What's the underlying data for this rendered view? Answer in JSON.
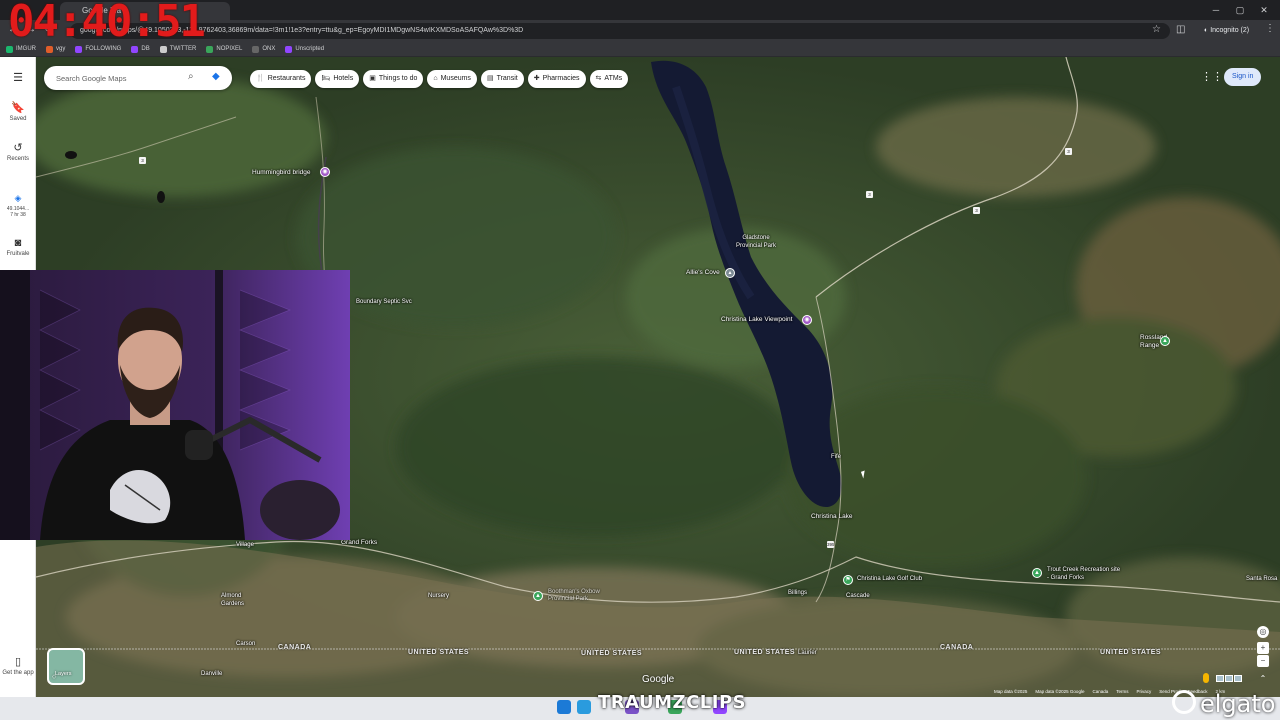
{
  "overlay": {
    "timer": "04:40:51",
    "clips_watermark": "TRAUMZCLIPS",
    "camera_brand": "elgato"
  },
  "browser": {
    "tab_title": "Google Ma",
    "url": "google.com/maps/@49.1050213,-117.9762403,36869m/data=!3m1!1e3?entry=ttu&g_ep=EgoyMDI1MDgwNS4wIKXMDSoASAFQAw%3D%3D",
    "profile_label": "Incognito (2)",
    "bookmarks": [
      {
        "label": "IMGUR",
        "color": "#1bb76e"
      },
      {
        "label": "vgy",
        "color": "#e05d2a"
      },
      {
        "label": "FOLLOWING",
        "color": "#9146ff"
      },
      {
        "label": "DB",
        "color": "#9146ff"
      },
      {
        "label": "TWITTER",
        "color": "#cccccc"
      },
      {
        "label": "NOPIXEL",
        "color": "#3aa65b"
      },
      {
        "label": "ONX",
        "color": "#666666"
      },
      {
        "label": "Unscripted",
        "color": "#9146ff"
      }
    ]
  },
  "sidebar": {
    "items": [
      {
        "label": "Saved",
        "icon": "bookmark-icon"
      },
      {
        "label": "Recents",
        "icon": "history-icon"
      },
      {
        "label": "49.1044...",
        "sub": "7 hr 38",
        "icon": "location-icon"
      },
      {
        "label": "Fruitvale",
        "icon": "place-icon"
      },
      {
        "label": "Get the app",
        "icon": "phone-icon"
      }
    ]
  },
  "search": {
    "placeholder": "Search Google Maps"
  },
  "chips": [
    {
      "label": "Restaurants",
      "icon": "🍴"
    },
    {
      "label": "Hotels",
      "icon": "🛏"
    },
    {
      "label": "Things to do",
      "icon": "▣"
    },
    {
      "label": "Museums",
      "icon": "⌂"
    },
    {
      "label": "Transit",
      "icon": "▤"
    },
    {
      "label": "Pharmacies",
      "icon": "✚"
    },
    {
      "label": "ATMs",
      "icon": "⇆"
    }
  ],
  "account": {
    "sign_in": "Sign in"
  },
  "map": {
    "places": [
      "Hummingbird bridge",
      "Boundary Septic Svc",
      "Gladstone Provincial Park",
      "Allie's Cove",
      "Christina Lake Viewpoint",
      "Rossland Range",
      "Fife",
      "Christina Lake",
      "Village",
      "Grand Forks",
      "Almond Gardens",
      "Nursery",
      "Boothman's Oxbow Provincial Park",
      "Billings",
      "Christina Lake Golf Club",
      "Cascade",
      "Trout Creek Recreation site - Grand Forks",
      "Santa Rosa",
      "Carson",
      "Danville",
      "Laurier"
    ],
    "borders": {
      "canada": "CANADA",
      "united_states": "UNITED STATES"
    },
    "highway_numbers": [
      "3",
      "3",
      "3",
      "3",
      "395"
    ],
    "layers_label": "Layers",
    "google_label": "Google",
    "attribution": [
      "Map data ©2025",
      "Map data ©2025 Google",
      "Canada",
      "Terms",
      "Privacy",
      "Send Product Feedback",
      "2 km"
    ]
  }
}
